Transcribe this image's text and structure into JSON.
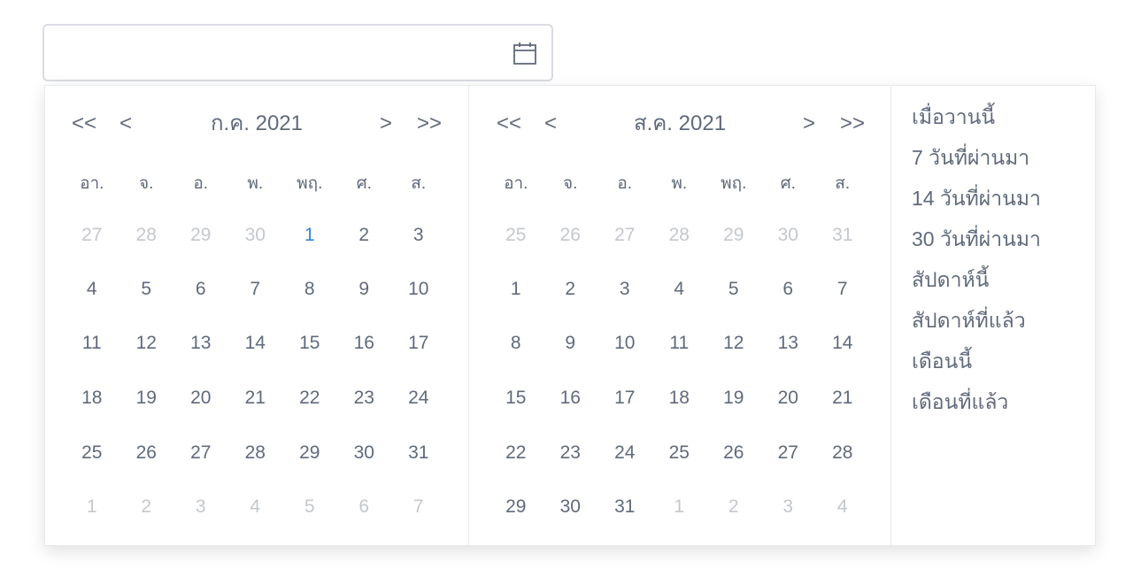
{
  "input": {
    "value": "",
    "placeholder": ""
  },
  "icons": {
    "calendar": "calendar-icon",
    "prev_year": "double-chevron-left",
    "prev_month": "chevron-left",
    "next_month": "chevron-right",
    "next_year": "double-chevron-right"
  },
  "nav": {
    "prev_year": "<<",
    "prev_month": "<",
    "next_month": ">",
    "next_year": ">>"
  },
  "weekdays": [
    "อา.",
    "จ.",
    "อ.",
    "พ.",
    "พฤ.",
    "ศ.",
    "ส."
  ],
  "left": {
    "title": "ก.ค. 2021",
    "weeks": [
      [
        "27",
        "28",
        "29",
        "30",
        "1",
        "2",
        "3"
      ],
      [
        "4",
        "5",
        "6",
        "7",
        "8",
        "9",
        "10"
      ],
      [
        "11",
        "12",
        "13",
        "14",
        "15",
        "16",
        "17"
      ],
      [
        "18",
        "19",
        "20",
        "21",
        "22",
        "23",
        "24"
      ],
      [
        "25",
        "26",
        "27",
        "28",
        "29",
        "30",
        "31"
      ],
      [
        "1",
        "2",
        "3",
        "4",
        "5",
        "6",
        "7"
      ]
    ]
  },
  "right": {
    "title": "ส.ค. 2021",
    "weeks": [
      [
        "25",
        "26",
        "27",
        "28",
        "29",
        "30",
        "31"
      ],
      [
        "1",
        "2",
        "3",
        "4",
        "5",
        "6",
        "7"
      ],
      [
        "8",
        "9",
        "10",
        "11",
        "12",
        "13",
        "14"
      ],
      [
        "15",
        "16",
        "17",
        "18",
        "19",
        "20",
        "21"
      ],
      [
        "22",
        "23",
        "24",
        "25",
        "26",
        "27",
        "28"
      ],
      [
        "29",
        "30",
        "31",
        "1",
        "2",
        "3",
        "4"
      ]
    ]
  },
  "shortcuts": [
    "เมื่อวานนี้",
    "7 วันที่ผ่านมา",
    "14 วันที่ผ่านมา",
    "30 วันที่ผ่านมา",
    "สัปดาห์นี้",
    "สัปดาห์ที่แล้ว",
    "เดือนนี้",
    "เดือนที่แล้ว"
  ],
  "colors": {
    "text": "#606a7b",
    "muted": "#c4c8cd",
    "today": "#2e86de",
    "border": "#d9dce1"
  }
}
